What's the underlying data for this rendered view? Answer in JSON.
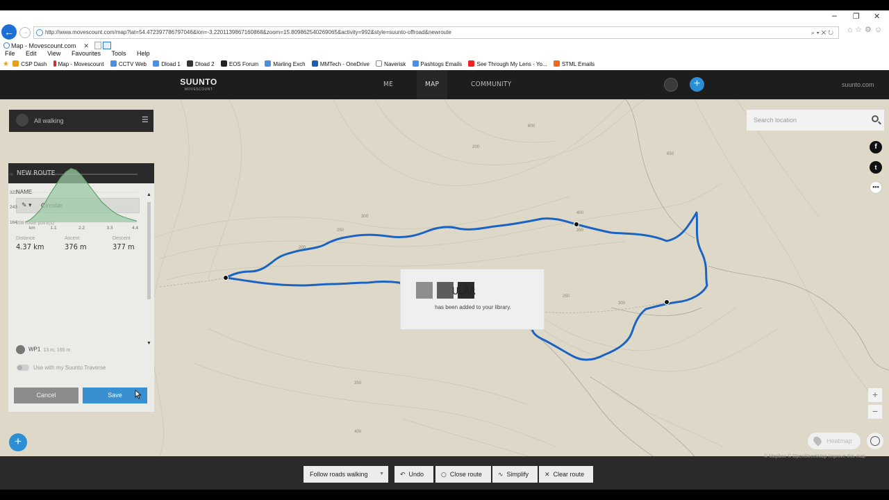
{
  "browser": {
    "window_buttons": {
      "minimize": "─",
      "restore": "❐",
      "close": "✕"
    },
    "url": "http://www.movescount.com/map?lat=54.47239778679704​6&lon=-3.2201139867160868&zoom=15.8098625402690​65&activity=992&style=suunto-offroad&newroute",
    "tab_title": "Map - Movescount.com",
    "menu": [
      "File",
      "Edit",
      "View",
      "Favourites",
      "Tools",
      "Help"
    ],
    "favourites": [
      "CSP Dash",
      "Map - Movescount",
      "CCTV Web",
      "Dload 1",
      "Dload 2",
      "EOS Forum",
      "Marling Exch",
      "MMTech - OneDrive",
      "Naverisk",
      "Pashtogs Emails",
      "See Through My Lens - Yo...",
      "STML Emails"
    ]
  },
  "site": {
    "brand": "SUUNTO",
    "brand_sub": "MOVESCOUNT",
    "nav": [
      "ME",
      "MAP",
      "COMMUNITY"
    ],
    "active_nav": "MAP",
    "external_link": "suunto.com"
  },
  "filter": {
    "label": "All walking"
  },
  "route_panel": {
    "title": "NEW ROUTE",
    "name_label": "NAME",
    "name_value": "Circular",
    "route_points": "208 route point(s)",
    "stats": [
      {
        "label": "Distance",
        "value": "4.37 km"
      },
      {
        "label": "Ascent",
        "value": "376 m"
      },
      {
        "label": "Descent",
        "value": "377 m"
      }
    ],
    "waypoint": {
      "name": "WP1",
      "detail": "13 m, 165 m"
    },
    "traverse_label": "Use with my Suunto Traverse",
    "cancel_label": "Cancel",
    "save_label": "Save"
  },
  "chart_data": {
    "type": "area",
    "title": "",
    "xlabel": "km",
    "ylabel": "m",
    "x_ticks": [
      "km",
      "1.1",
      "2.2",
      "3.3",
      "4.4"
    ],
    "y_ticks": [
      "m",
      "323",
      "243",
      "164"
    ],
    "x": [
      0,
      0.2,
      0.4,
      0.6,
      0.8,
      1.0,
      1.2,
      1.4,
      1.6,
      1.8,
      2.0,
      2.2,
      2.4,
      2.6,
      2.8,
      3.0,
      3.2,
      3.4,
      3.6,
      3.8,
      4.0,
      4.2,
      4.37
    ],
    "y": [
      164,
      175,
      195,
      220,
      255,
      295,
      330,
      365,
      390,
      405,
      398,
      375,
      345,
      315,
      285,
      255,
      235,
      215,
      200,
      190,
      182,
      175,
      170
    ],
    "ylim": [
      164,
      410
    ],
    "xlim": [
      0,
      4.4
    ],
    "fill_color": "#9cc8a4",
    "line_color": "#4e9a5c"
  },
  "map": {
    "search_placeholder": "Search location",
    "social": [
      "f",
      "t",
      "•••"
    ],
    "zoom_in": "+",
    "zoom_out": "−",
    "heatmap_label": "Heatmap",
    "add_button": "+",
    "attribution": "© Mapbox © OpenStreetMap  Improve this map",
    "contour_labels": [
      "200",
      "250",
      "300",
      "350",
      "400",
      "600",
      "650",
      "200",
      "250",
      "300",
      "350",
      "400"
    ],
    "route_color": "#1b63c2"
  },
  "toast": {
    "title_visible": "ULAR",
    "message": "has been added to your library."
  },
  "toolbar": {
    "follow_roads": "Follow roads walking",
    "undo": "Undo",
    "close_route": "Close route",
    "simplify": "Simplify",
    "clear_route": "Clear route"
  }
}
